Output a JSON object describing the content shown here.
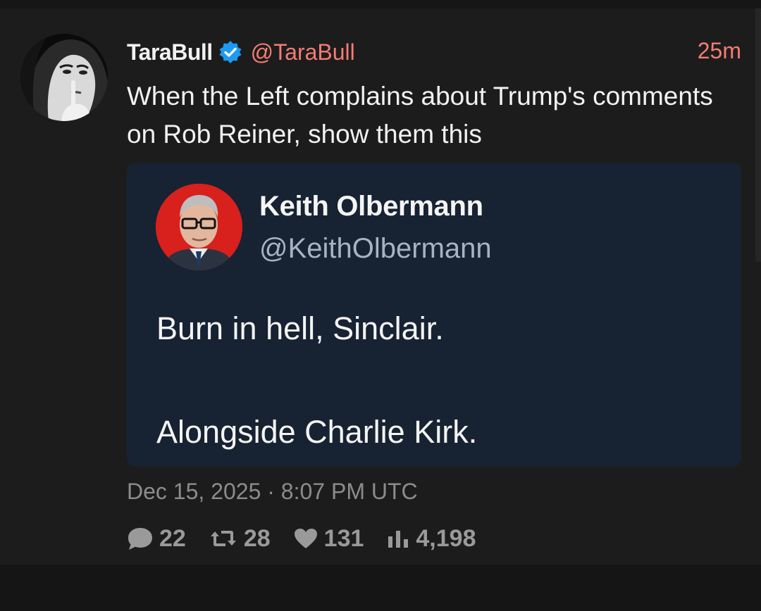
{
  "tweet": {
    "author": {
      "display_name": "TaraBull",
      "handle": "@TaraBull",
      "verified_icon": "verified-badge-icon"
    },
    "time_ago": "25m",
    "text": "When the Left complains about Trump's comments on Rob Reiner, show them this",
    "quoted": {
      "display_name": "Keith Olbermann",
      "handle": "@KeithOlbermann",
      "line1": "Burn in hell, Sinclair.",
      "line2": "Alongside Charlie Kirk."
    },
    "date": "Dec 15, 2025 · 8:07 PM UTC",
    "stats": {
      "replies": "22",
      "retweets": "28",
      "likes": "131",
      "views": "4,198"
    }
  },
  "colors": {
    "background": "#1c1c1c",
    "accent": "#f47c73",
    "verified": "#1d9bf0",
    "quote_background": "#172232",
    "muted": "#8c8c8c"
  }
}
